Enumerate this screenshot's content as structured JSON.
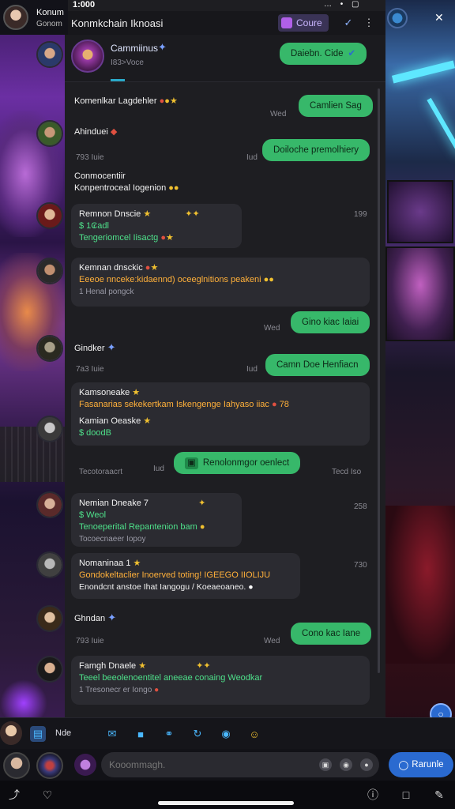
{
  "status": {
    "time": "1:000",
    "icons": "… • ▢"
  },
  "top_left": {
    "name": "Konum",
    "sub": "Gonom"
  },
  "header": {
    "title": "Konmkchain Iknoasi",
    "badge_label": "Coure"
  },
  "chat": {
    "name": "Cammiinus",
    "sub": "I83>Voce"
  },
  "messages": [
    {
      "kind": "out",
      "text": "Daiebn. Cide",
      "check": true
    },
    {
      "kind": "in",
      "name": "Komenlkar Lagdehler"
    },
    {
      "kind": "out",
      "text": "Camlien Sag",
      "ts": "Wed"
    },
    {
      "kind": "in",
      "name": "Ahinduei"
    },
    {
      "kind": "out",
      "text": "Doiloche premolhiery"
    },
    {
      "kind": "time",
      "text": "793 Iuie",
      "ts": "Iud"
    },
    {
      "kind": "text",
      "line1": "Conmocentiir",
      "line2": "Konpentroceal Iogenion"
    },
    {
      "kind": "in",
      "name": "Remnon Dnscie",
      "line2": "$ 1₢adl",
      "line3": "Tengeriomcel Iisactg",
      "ts": "199"
    },
    {
      "kind": "in",
      "name": "Kemnan dnsckic",
      "line2": "Eeeoe nnceke:kidaennd) oceeglnitions peakeni",
      "line3": "1 Henal pongck"
    },
    {
      "kind": "out",
      "text": "Gino kiac Iaiai",
      "ts": "Wed"
    },
    {
      "kind": "in",
      "name": "Gindker"
    },
    {
      "kind": "out",
      "text": "Camn Doe Henfiacn",
      "ts": "Iud"
    },
    {
      "kind": "time",
      "text": "7a3 Iuie"
    },
    {
      "kind": "in",
      "name": "Kamsoneake",
      "line2": "Fasanarias sekekertkam Iskengenge Iahyaso iiac",
      "line2b": "78",
      "line3": "Kamian Oeaske",
      "line4": "$ doodB"
    },
    {
      "kind": "out",
      "text": "Renolonmgor oenlect",
      "ts": "Iud"
    },
    {
      "kind": "time",
      "text": "Tecotoraacrt",
      "ts": "Tecd Iso"
    },
    {
      "kind": "in",
      "name": "Nemian Dneake 7",
      "line2": "$ Weol",
      "line3": "Tenoeperital Repantenion bam",
      "line4": "Tocoecnaeer Iopoy",
      "ts": "258"
    },
    {
      "kind": "in",
      "name": "Nomaninaa 1",
      "line2": "Gondokeltaclier Inoerved toting! IGEEGO IIOLIJU",
      "line3": "Enondcnt anstoe Ihat Iangogu / Koeaeoaneo.",
      "ts": "730"
    },
    {
      "kind": "in",
      "name": "Ghndan"
    },
    {
      "kind": "time",
      "text": "793 Iuie"
    },
    {
      "kind": "out",
      "text": "Cono kac Iane",
      "ts": "Wed"
    },
    {
      "kind": "in",
      "name": "Famgh Dnaele",
      "line2": "Teeel beeolenoentitel aneeae conaing Weodkar",
      "line3": "1 Tresonecr er Iongo"
    }
  ],
  "toolbar": {
    "label": "Nde"
  },
  "composer": {
    "placeholder": "Kooommagh.",
    "send_label": "Rarunle"
  },
  "colors": {
    "accent_green": "#37b86a",
    "accent_blue": "#2a6ad0",
    "panel_bg": "#1e1e22"
  }
}
